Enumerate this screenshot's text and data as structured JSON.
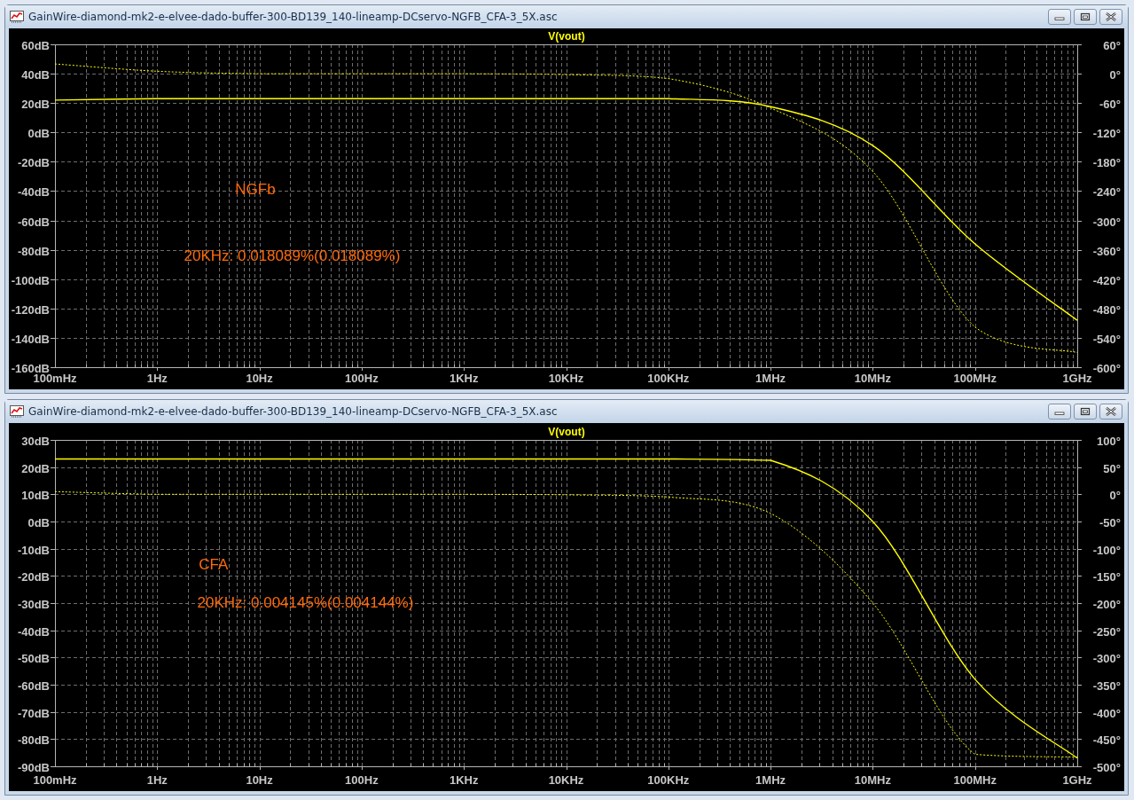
{
  "windows": [
    {
      "title": "GainWire-diamond-mk2-e-elvee-dado-buffer-300-BD139_140-lineamp-DCservo-NGFB_CFA-3_5X.asc",
      "chart_data": {
        "type": "line",
        "title": "V(vout)",
        "categories": [
          "100mHz",
          "1Hz",
          "10Hz",
          "100Hz",
          "1KHz",
          "10KHz",
          "100KHz",
          "1MHz",
          "10MHz",
          "100MHz",
          "1GHz"
        ],
        "ylim": [
          -160,
          60
        ],
        "yticks": [
          {
            "value": 60,
            "label": "60dB"
          },
          {
            "value": 40,
            "label": "40dB"
          },
          {
            "value": 20,
            "label": "20dB"
          },
          {
            "value": 0,
            "label": "0dB"
          },
          {
            "value": -20,
            "label": "-20dB"
          },
          {
            "value": -40,
            "label": "-40dB"
          },
          {
            "value": -60,
            "label": "-60dB"
          },
          {
            "value": -80,
            "label": "-80dB"
          },
          {
            "value": -100,
            "label": "-100dB"
          },
          {
            "value": -120,
            "label": "-120dB"
          },
          {
            "value": -140,
            "label": "-140dB"
          },
          {
            "value": -160,
            "label": "-160dB"
          }
        ],
        "y2lim": [
          -600,
          60
        ],
        "y2ticks": [
          {
            "value": 60,
            "label": "60°"
          },
          {
            "value": 0,
            "label": "0°"
          },
          {
            "value": -60,
            "label": "-60°"
          },
          {
            "value": -120,
            "label": "-120°"
          },
          {
            "value": -180,
            "label": "-180°"
          },
          {
            "value": -240,
            "label": "-240°"
          },
          {
            "value": -300,
            "label": "-300°"
          },
          {
            "value": -360,
            "label": "-360°"
          },
          {
            "value": -420,
            "label": "-420°"
          },
          {
            "value": -480,
            "label": "-480°"
          },
          {
            "value": -540,
            "label": "-540°"
          },
          {
            "value": -600,
            "label": "-600°"
          }
        ],
        "series": [
          {
            "color": "#ffff00",
            "line_style": "solid",
            "values": [
              22,
              23,
              23,
              23,
              23,
              23,
              23,
              17.5,
              -9,
              -76,
              -128
            ]
          },
          {
            "color": "#ffff00",
            "line_style": "dashed",
            "axis": "y2",
            "values": [
              20,
              5,
              0,
              0,
              0,
              -2,
              -10,
              -70,
              -200,
              -518,
              -570
            ]
          }
        ],
        "grid": true,
        "annotations": [
          "NGFb",
          "20KHz: 0.018089%(0.018089%)"
        ]
      }
    },
    {
      "title": "GainWire-diamond-mk2-e-elvee-dado-buffer-300-BD139_140-lineamp-DCservo-NGFB_CFA-3_5X.asc",
      "chart_data": {
        "type": "line",
        "title": "V(vout)",
        "categories": [
          "100mHz",
          "1Hz",
          "10Hz",
          "100Hz",
          "1KHz",
          "10KHz",
          "100KHz",
          "1MHz",
          "10MHz",
          "100MHz",
          "1GHz"
        ],
        "ylim": [
          -90,
          30
        ],
        "yticks": [
          {
            "value": 30,
            "label": "30dB"
          },
          {
            "value": 20,
            "label": "20dB"
          },
          {
            "value": 10,
            "label": "10dB"
          },
          {
            "value": 0,
            "label": "0dB"
          },
          {
            "value": -10,
            "label": "-10dB"
          },
          {
            "value": -20,
            "label": "-20dB"
          },
          {
            "value": -30,
            "label": "-30dB"
          },
          {
            "value": -40,
            "label": "-40dB"
          },
          {
            "value": -50,
            "label": "-50dB"
          },
          {
            "value": -60,
            "label": "-60dB"
          },
          {
            "value": -70,
            "label": "-70dB"
          },
          {
            "value": -80,
            "label": "-80dB"
          },
          {
            "value": -90,
            "label": "-90dB"
          }
        ],
        "y2lim": [
          -500,
          100
        ],
        "y2ticks": [
          {
            "value": 100,
            "label": "100°"
          },
          {
            "value": 50,
            "label": "50°"
          },
          {
            "value": 0,
            "label": "0°"
          },
          {
            "value": -50,
            "label": "-50°"
          },
          {
            "value": -100,
            "label": "-100°"
          },
          {
            "value": -150,
            "label": "-150°"
          },
          {
            "value": -200,
            "label": "-200°"
          },
          {
            "value": -250,
            "label": "-250°"
          },
          {
            "value": -300,
            "label": "-300°"
          },
          {
            "value": -350,
            "label": "-350°"
          },
          {
            "value": -400,
            "label": "-400°"
          },
          {
            "value": -450,
            "label": "-450°"
          },
          {
            "value": -500,
            "label": "-500°"
          }
        ],
        "series": [
          {
            "color": "#ffff00",
            "line_style": "solid",
            "values": [
              23,
              23,
              23,
              23,
              23,
              23,
              23,
              22.5,
              0,
              -58,
              -87
            ]
          },
          {
            "color": "#ffff00",
            "line_style": "dashed",
            "axis": "y2",
            "values": [
              5,
              0,
              0,
              0,
              0,
              -1,
              -5,
              -35,
              -200,
              -478,
              -483
            ]
          }
        ],
        "grid": true,
        "annotations": [
          "CFA",
          "20KHz: 0.004145%(0.004144%)"
        ]
      }
    }
  ]
}
